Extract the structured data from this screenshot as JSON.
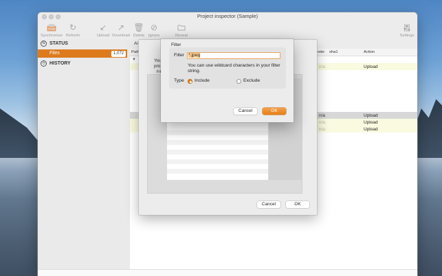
{
  "window": {
    "title": "Project inspector (Sample)"
  },
  "toolbar": {
    "synchronize": "Synchronize",
    "refresh": "Refresh",
    "upload": "Upload",
    "download": "Download",
    "delete": "Delete",
    "ignore": "Ignore",
    "reveal": "Reveal",
    "settings": "Settings"
  },
  "sidebar": {
    "status": "STATUS",
    "files": "Files",
    "files_count": "1,072",
    "history": "HISTORY"
  },
  "main": {
    "filter_prefix": "Al",
    "columns": {
      "path": "Path",
      "remote": "mote",
      "sha1": "sha1",
      "action": "Action"
    },
    "rows": [
      {
        "sha1": "n/a",
        "action": "Upload",
        "highlight": "#fafae0"
      },
      {
        "sha1": "n/a",
        "action": "Upload",
        "highlight": "#d8d8d8"
      },
      {
        "sha1": "n/a",
        "action": "Upload",
        "highlight": "#fafae0"
      },
      {
        "sha1": "n/a",
        "action": "Upload",
        "highlight": "#fafae0"
      }
    ]
  },
  "sheet": {
    "text_you": "You",
    "text_proj": "proj",
    "text_filt": "Filt",
    "cancel": "Cancel",
    "ok": "OK"
  },
  "dialog": {
    "header": "Filter",
    "filter_label": "Filter",
    "filter_value": "*.jpeg",
    "hint": "You can use wildcard characters in your filter string.",
    "type_label": "Type",
    "include": "Include",
    "exclude": "Exclude",
    "selected_type": "Include",
    "cancel": "Cancel",
    "ok": "OK"
  },
  "colors": {
    "accent": "#e57f17",
    "row_highlight": "#fafae0"
  }
}
